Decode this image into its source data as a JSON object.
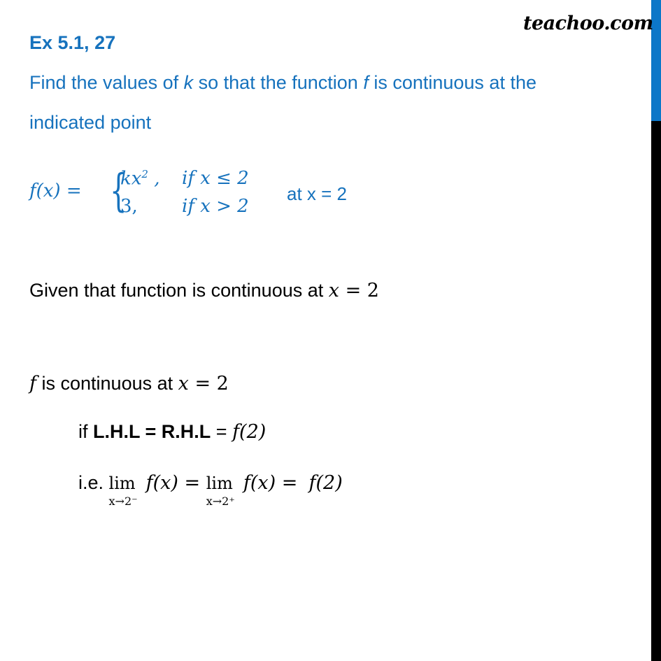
{
  "brand": {
    "logo_text": "teachoo.com",
    "accent_color": "#1672bd",
    "bar_top_color": "#0c77c8",
    "bar_bottom_color": "#000000"
  },
  "header": {
    "title": "Ex 5.1, 27"
  },
  "question": {
    "line1_part1": "Find the values of ",
    "line1_k": "k",
    "line1_part2": " so that the function ",
    "line1_f": "f",
    "line1_part3": " is continuous at the",
    "line2": "indicated point"
  },
  "function_def": {
    "lhs": "f(x) =",
    "case1_expr": "kx",
    "case1_exp": "2",
    "case1_tail": " ,",
    "case1_cond": "if x ≤ 2",
    "case2_expr": "3,",
    "case2_cond": "if x > 2",
    "at_point": "at   x = 2"
  },
  "solution": {
    "given_text": "Given  that function is continuous at ",
    "given_var": "x",
    "given_eq": " = 2",
    "cont_f": "f",
    "cont_text": " is continuous at ",
    "cont_var": "x",
    "cont_eq": " = 2",
    "if_prefix": "if  ",
    "if_bold": "L.H.L = R.H.L",
    "if_eq": " = ",
    "if_f2": "f(2)",
    "ie_prefix": "i.e. ",
    "lim_word": "lim",
    "lim1_sub": "x→2⁻",
    "lim2_sub": "x→2⁺",
    "fx": "f(x)",
    "equals": " = ",
    "f2": "f(2)"
  }
}
